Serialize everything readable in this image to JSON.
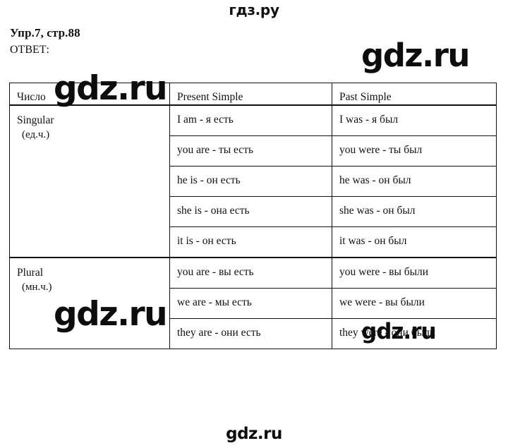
{
  "site_label": "гдз.ру",
  "heading": {
    "exercise": "Упр.7, стр.88",
    "answer_label": "ОТВЕТ:"
  },
  "table": {
    "columns": [
      "Число",
      "Present Simple",
      "Past Simple"
    ],
    "groups": [
      {
        "name": "Singular",
        "abbr": "(ед.ч.)",
        "rows": [
          {
            "present": "I am - я есть",
            "past": "I was - я был"
          },
          {
            "present": "you are - ты есть",
            "past": "you were - ты был"
          },
          {
            "present": "he is - он есть",
            "past": "he was - он был"
          },
          {
            "present": "she is - она есть",
            "past": "she was - он был"
          },
          {
            "present": "it is - он есть",
            "past": "it was - он был"
          }
        ]
      },
      {
        "name": "Plural",
        "abbr": "(мн.ч.)",
        "rows": [
          {
            "present": "you are - вы есть",
            "past": "you were - вы были"
          },
          {
            "present": "we are - мы есть",
            "past": "we were - вы были"
          },
          {
            "present": "they are - они есть",
            "past": "they were - они были"
          }
        ]
      }
    ]
  },
  "watermarks": {
    "a": "gdz.ru",
    "b": "gdz.ru",
    "c": "gdz.ru",
    "d": "gdz.ru",
    "e": "gdz.ru"
  }
}
